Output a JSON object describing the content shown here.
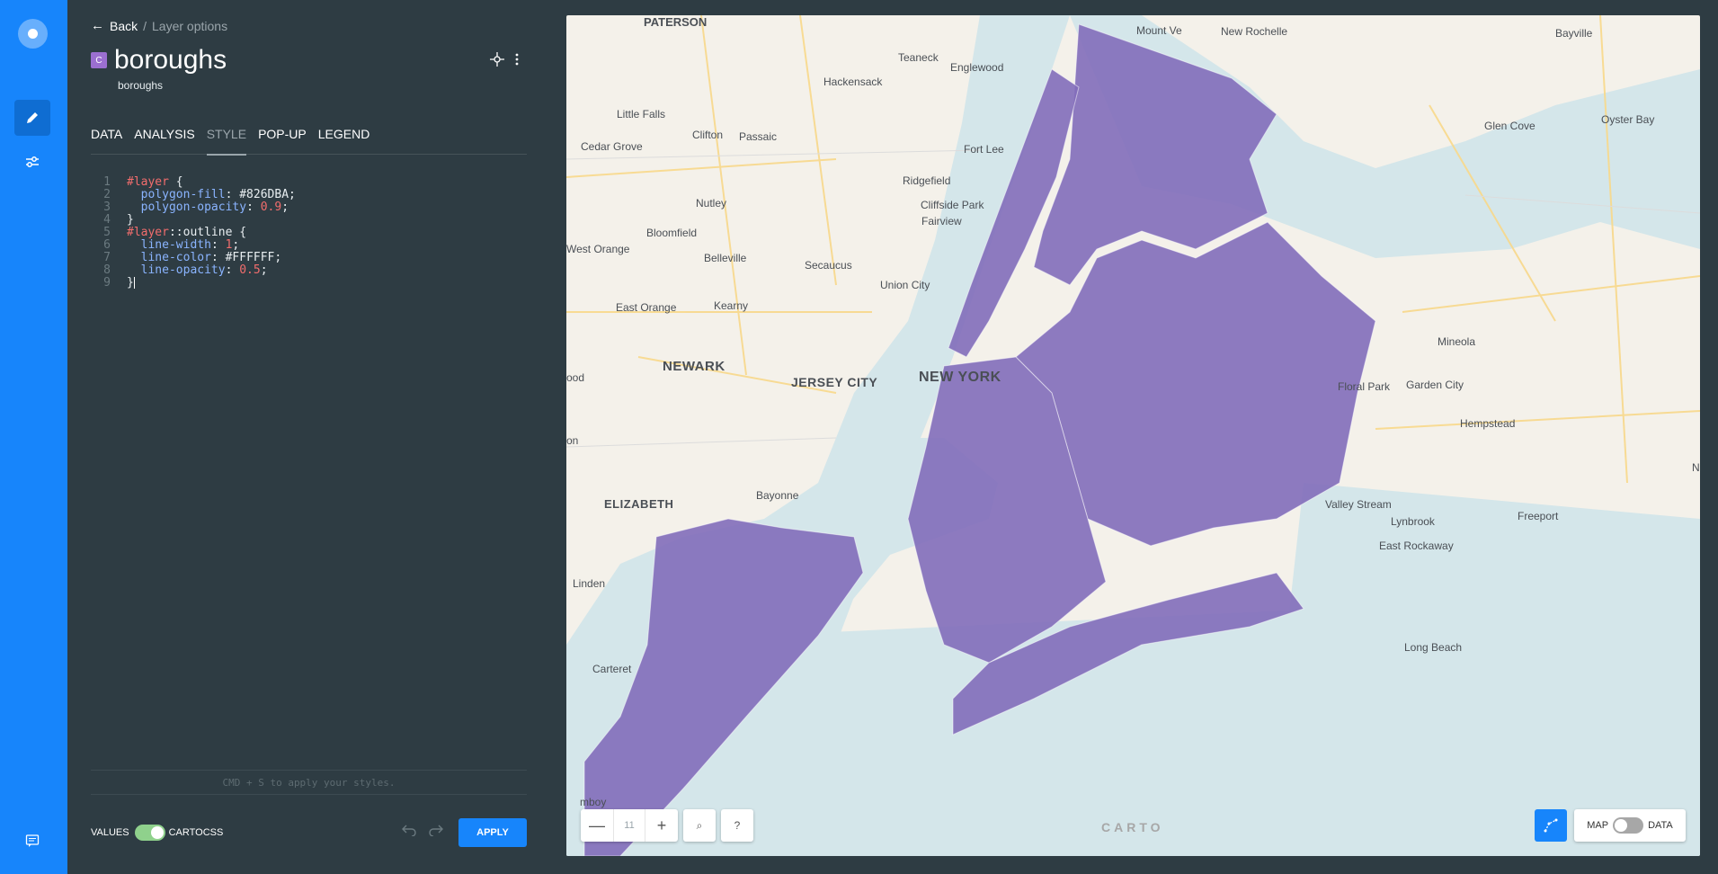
{
  "breadcrumb": {
    "back_label": "Back",
    "separator": "/",
    "current": "Layer options"
  },
  "layer": {
    "badge": "C",
    "title": "boroughs",
    "subtitle": "boroughs",
    "fill_color": "#826DBA"
  },
  "tabs": [
    {
      "label": "DATA"
    },
    {
      "label": "ANALYSIS"
    },
    {
      "label": "STYLE",
      "selected": true
    },
    {
      "label": "POP-UP"
    },
    {
      "label": "LEGEND"
    }
  ],
  "editor": {
    "lines": [
      {
        "n": "1",
        "sel": "#layer",
        "tail": " {"
      },
      {
        "n": "2",
        "prop": "polygon-fill",
        "val": "#826DBA",
        "num": ""
      },
      {
        "n": "3",
        "prop": "polygon-opacity",
        "val": "",
        "num": "0.9"
      },
      {
        "n": "4",
        "sel": "",
        "tail": "}"
      },
      {
        "n": "5",
        "sel": "#layer",
        "tail": "::outline {"
      },
      {
        "n": "6",
        "prop": "line-width",
        "val": "",
        "num": "1"
      },
      {
        "n": "7",
        "prop": "line-color",
        "val": "#FFFFFF",
        "num": ""
      },
      {
        "n": "8",
        "prop": "line-opacity",
        "val": "",
        "num": "0.5"
      },
      {
        "n": "9",
        "sel": "",
        "tail": "}"
      }
    ],
    "hint": "CMD + S to apply your styles."
  },
  "footer": {
    "values_label": "VALUES",
    "cartocss_label": "CARTOCSS",
    "apply_label": "APPLY"
  },
  "map": {
    "zoom_level": "11",
    "zoom_out": "—",
    "zoom_in": "+",
    "search_icon": "⌕",
    "help_label": "?",
    "attribution": "CARTO",
    "view_map_label": "MAP",
    "view_data_label": "DATA",
    "places": [
      "PATERSON",
      "Mount Ve",
      "New Rochelle",
      "Bayville",
      "Teaneck",
      "Englewood",
      "Hackensack",
      "Little Falls",
      "Glen Cove",
      "Oyster Bay",
      "Clifton",
      "Passaic",
      "Fort Lee",
      "Cedar Grove",
      "Ridgefield",
      "Nutley",
      "Cliffside Park",
      "Fairview",
      "Bloomfield",
      "West Orange",
      "Belleville",
      "Secaucus",
      "Union City",
      "East Orange",
      "Kearny",
      "Mineola",
      "NEWARK",
      "JERSEY CITY",
      "NEW YORK",
      "Floral Park",
      "Garden City",
      "ood",
      "Hempstead",
      "on",
      "Bayonne",
      "ELIZABETH",
      "Valley Stream",
      "Lynbrook",
      "Freeport",
      "East Rockaway",
      "Linden",
      "Carteret",
      "Long Beach",
      "mboy",
      "N"
    ]
  }
}
